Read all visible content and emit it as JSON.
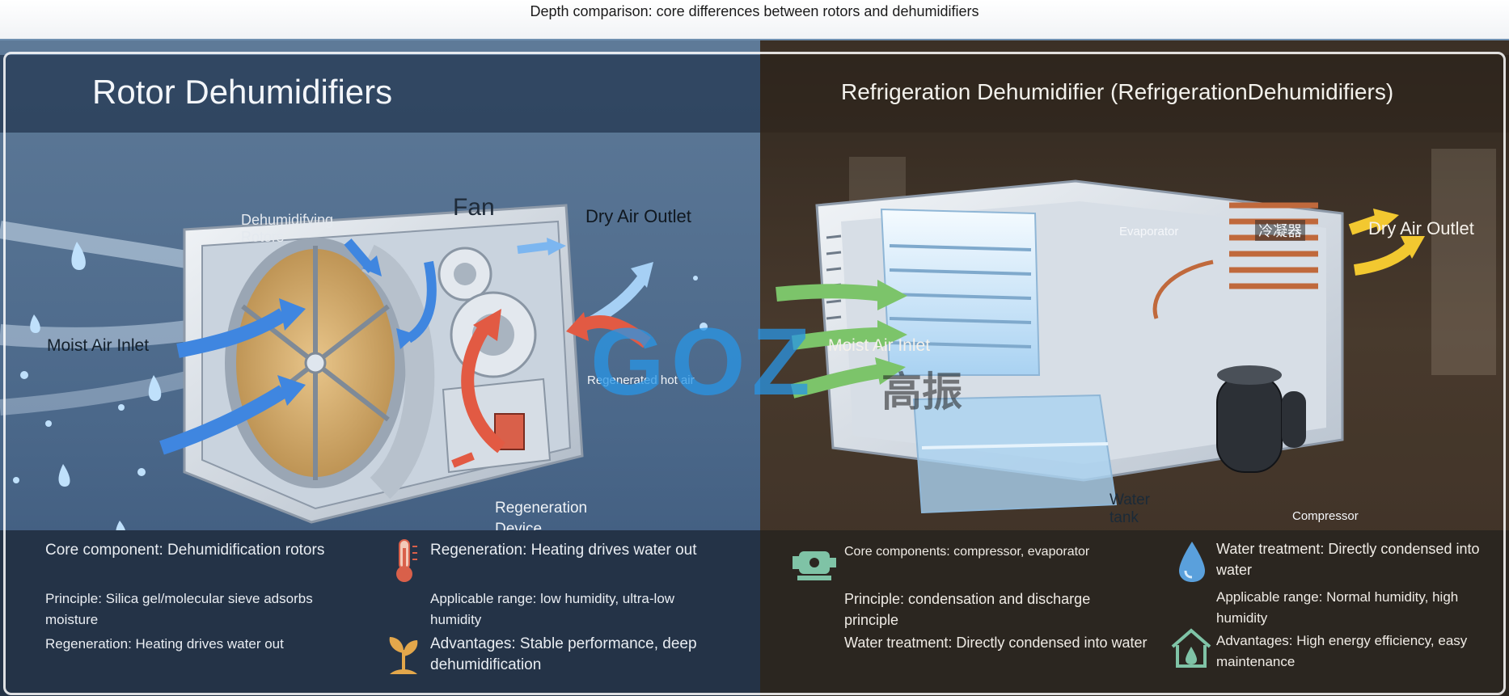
{
  "header": {
    "title": "Depth comparison: core differences between rotors and dehumidifiers"
  },
  "left": {
    "title": "Rotor Dehumidifiers",
    "labels": {
      "rotor": "Dehumidifying\nRotors",
      "fan": "Fan",
      "dry_outlet": "Dry Air Outlet",
      "moist_inlet": "Moist Air Inlet",
      "regen_air": "Regenerated hot air",
      "regen_device": "Regeneration\nDevice"
    },
    "bottom": {
      "col1": [
        "Core component: Dehumidification rotors",
        "Principle: Silica gel/molecular sieve adsorbs moisture",
        "Regeneration: Heating drives water out"
      ],
      "col2": [
        "Regeneration: Heating drives water out",
        "Applicable range: low humidity, ultra-low humidity",
        "Advantages: Stable performance, deep dehumidification"
      ]
    },
    "icons": [
      "thermometer-icon",
      "sprout-icon"
    ]
  },
  "right": {
    "title": "Refrigeration Dehumidifier (RefrigerationDehumidifiers)",
    "labels": {
      "evaporator": "Evaporator",
      "condenser": "冷凝器",
      "dry_outlet": "Dry Air Outlet",
      "moist_inlet": "Moist Air Inlet",
      "water_tank": "Water\ntank",
      "compressor": "Compressor"
    },
    "bottom": {
      "col1": [
        "Core components: compressor, evaporator",
        "Principle: condensation and discharge principle",
        "Water treatment: Directly condensed into water"
      ],
      "col2": [
        "Water treatment: Directly condensed into water",
        "Applicable range: Normal humidity, high humidity",
        "Advantages: High energy efficiency, easy maintenance"
      ]
    },
    "icons": [
      "compressor-icon",
      "water-drop-icon",
      "house-drop-icon"
    ]
  },
  "watermark": {
    "latin": "GOZ",
    "cn": "高振"
  },
  "colors": {
    "left_accent": "#4a6789",
    "right_accent": "#4a3b2e",
    "arrow_blue": "#3f86e0",
    "arrow_red": "#e25a43",
    "arrow_green": "#7cc46a",
    "arrow_yellow": "#f2c830"
  }
}
